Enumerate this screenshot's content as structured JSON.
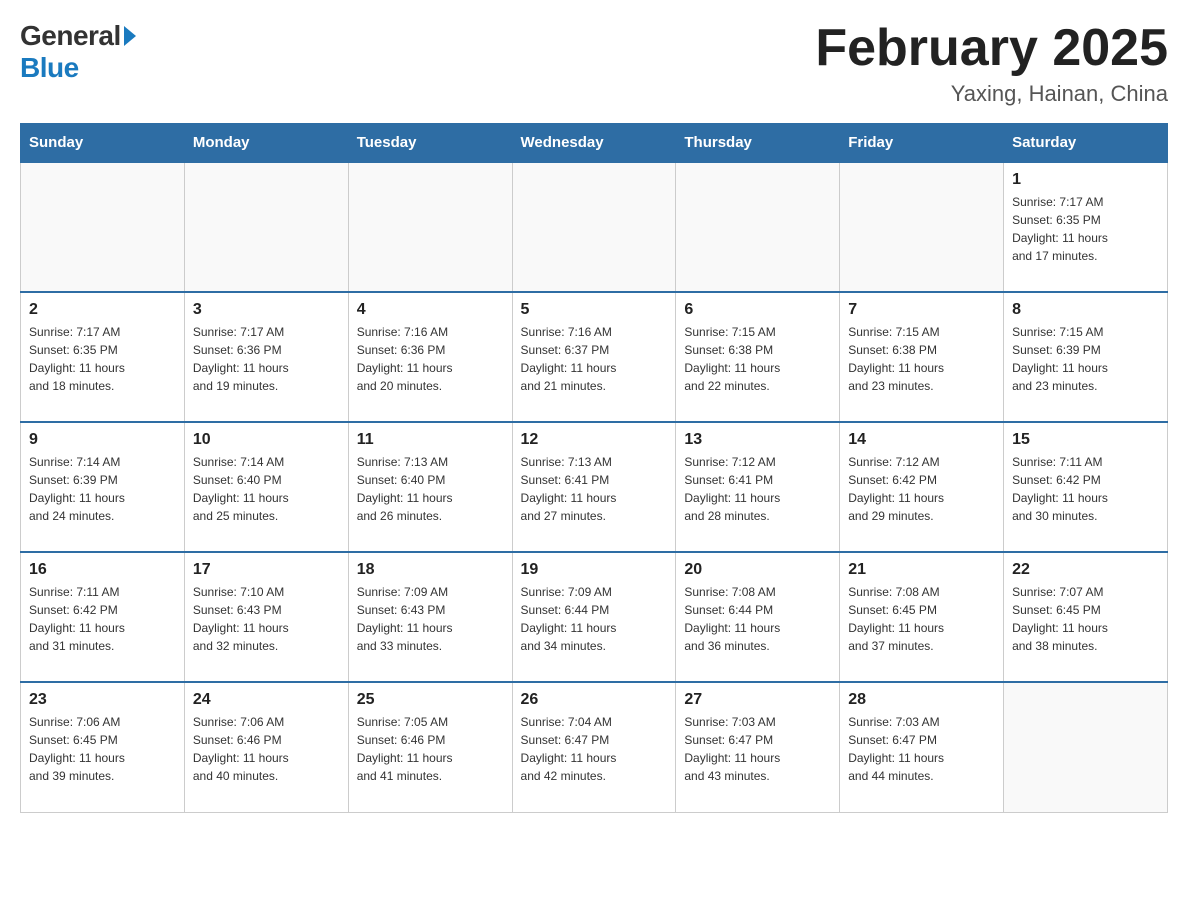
{
  "header": {
    "logo_general": "General",
    "logo_blue": "Blue",
    "title": "February 2025",
    "subtitle": "Yaxing, Hainan, China"
  },
  "weekdays": [
    "Sunday",
    "Monday",
    "Tuesday",
    "Wednesday",
    "Thursday",
    "Friday",
    "Saturday"
  ],
  "weeks": [
    [
      {
        "day": "",
        "info": ""
      },
      {
        "day": "",
        "info": ""
      },
      {
        "day": "",
        "info": ""
      },
      {
        "day": "",
        "info": ""
      },
      {
        "day": "",
        "info": ""
      },
      {
        "day": "",
        "info": ""
      },
      {
        "day": "1",
        "info": "Sunrise: 7:17 AM\nSunset: 6:35 PM\nDaylight: 11 hours\nand 17 minutes."
      }
    ],
    [
      {
        "day": "2",
        "info": "Sunrise: 7:17 AM\nSunset: 6:35 PM\nDaylight: 11 hours\nand 18 minutes."
      },
      {
        "day": "3",
        "info": "Sunrise: 7:17 AM\nSunset: 6:36 PM\nDaylight: 11 hours\nand 19 minutes."
      },
      {
        "day": "4",
        "info": "Sunrise: 7:16 AM\nSunset: 6:36 PM\nDaylight: 11 hours\nand 20 minutes."
      },
      {
        "day": "5",
        "info": "Sunrise: 7:16 AM\nSunset: 6:37 PM\nDaylight: 11 hours\nand 21 minutes."
      },
      {
        "day": "6",
        "info": "Sunrise: 7:15 AM\nSunset: 6:38 PM\nDaylight: 11 hours\nand 22 minutes."
      },
      {
        "day": "7",
        "info": "Sunrise: 7:15 AM\nSunset: 6:38 PM\nDaylight: 11 hours\nand 23 minutes."
      },
      {
        "day": "8",
        "info": "Sunrise: 7:15 AM\nSunset: 6:39 PM\nDaylight: 11 hours\nand 23 minutes."
      }
    ],
    [
      {
        "day": "9",
        "info": "Sunrise: 7:14 AM\nSunset: 6:39 PM\nDaylight: 11 hours\nand 24 minutes."
      },
      {
        "day": "10",
        "info": "Sunrise: 7:14 AM\nSunset: 6:40 PM\nDaylight: 11 hours\nand 25 minutes."
      },
      {
        "day": "11",
        "info": "Sunrise: 7:13 AM\nSunset: 6:40 PM\nDaylight: 11 hours\nand 26 minutes."
      },
      {
        "day": "12",
        "info": "Sunrise: 7:13 AM\nSunset: 6:41 PM\nDaylight: 11 hours\nand 27 minutes."
      },
      {
        "day": "13",
        "info": "Sunrise: 7:12 AM\nSunset: 6:41 PM\nDaylight: 11 hours\nand 28 minutes."
      },
      {
        "day": "14",
        "info": "Sunrise: 7:12 AM\nSunset: 6:42 PM\nDaylight: 11 hours\nand 29 minutes."
      },
      {
        "day": "15",
        "info": "Sunrise: 7:11 AM\nSunset: 6:42 PM\nDaylight: 11 hours\nand 30 minutes."
      }
    ],
    [
      {
        "day": "16",
        "info": "Sunrise: 7:11 AM\nSunset: 6:42 PM\nDaylight: 11 hours\nand 31 minutes."
      },
      {
        "day": "17",
        "info": "Sunrise: 7:10 AM\nSunset: 6:43 PM\nDaylight: 11 hours\nand 32 minutes."
      },
      {
        "day": "18",
        "info": "Sunrise: 7:09 AM\nSunset: 6:43 PM\nDaylight: 11 hours\nand 33 minutes."
      },
      {
        "day": "19",
        "info": "Sunrise: 7:09 AM\nSunset: 6:44 PM\nDaylight: 11 hours\nand 34 minutes."
      },
      {
        "day": "20",
        "info": "Sunrise: 7:08 AM\nSunset: 6:44 PM\nDaylight: 11 hours\nand 36 minutes."
      },
      {
        "day": "21",
        "info": "Sunrise: 7:08 AM\nSunset: 6:45 PM\nDaylight: 11 hours\nand 37 minutes."
      },
      {
        "day": "22",
        "info": "Sunrise: 7:07 AM\nSunset: 6:45 PM\nDaylight: 11 hours\nand 38 minutes."
      }
    ],
    [
      {
        "day": "23",
        "info": "Sunrise: 7:06 AM\nSunset: 6:45 PM\nDaylight: 11 hours\nand 39 minutes."
      },
      {
        "day": "24",
        "info": "Sunrise: 7:06 AM\nSunset: 6:46 PM\nDaylight: 11 hours\nand 40 minutes."
      },
      {
        "day": "25",
        "info": "Sunrise: 7:05 AM\nSunset: 6:46 PM\nDaylight: 11 hours\nand 41 minutes."
      },
      {
        "day": "26",
        "info": "Sunrise: 7:04 AM\nSunset: 6:47 PM\nDaylight: 11 hours\nand 42 minutes."
      },
      {
        "day": "27",
        "info": "Sunrise: 7:03 AM\nSunset: 6:47 PM\nDaylight: 11 hours\nand 43 minutes."
      },
      {
        "day": "28",
        "info": "Sunrise: 7:03 AM\nSunset: 6:47 PM\nDaylight: 11 hours\nand 44 minutes."
      },
      {
        "day": "",
        "info": ""
      }
    ]
  ],
  "colors": {
    "header_bg": "#2e6da4",
    "border_top": "#2e6da4"
  }
}
